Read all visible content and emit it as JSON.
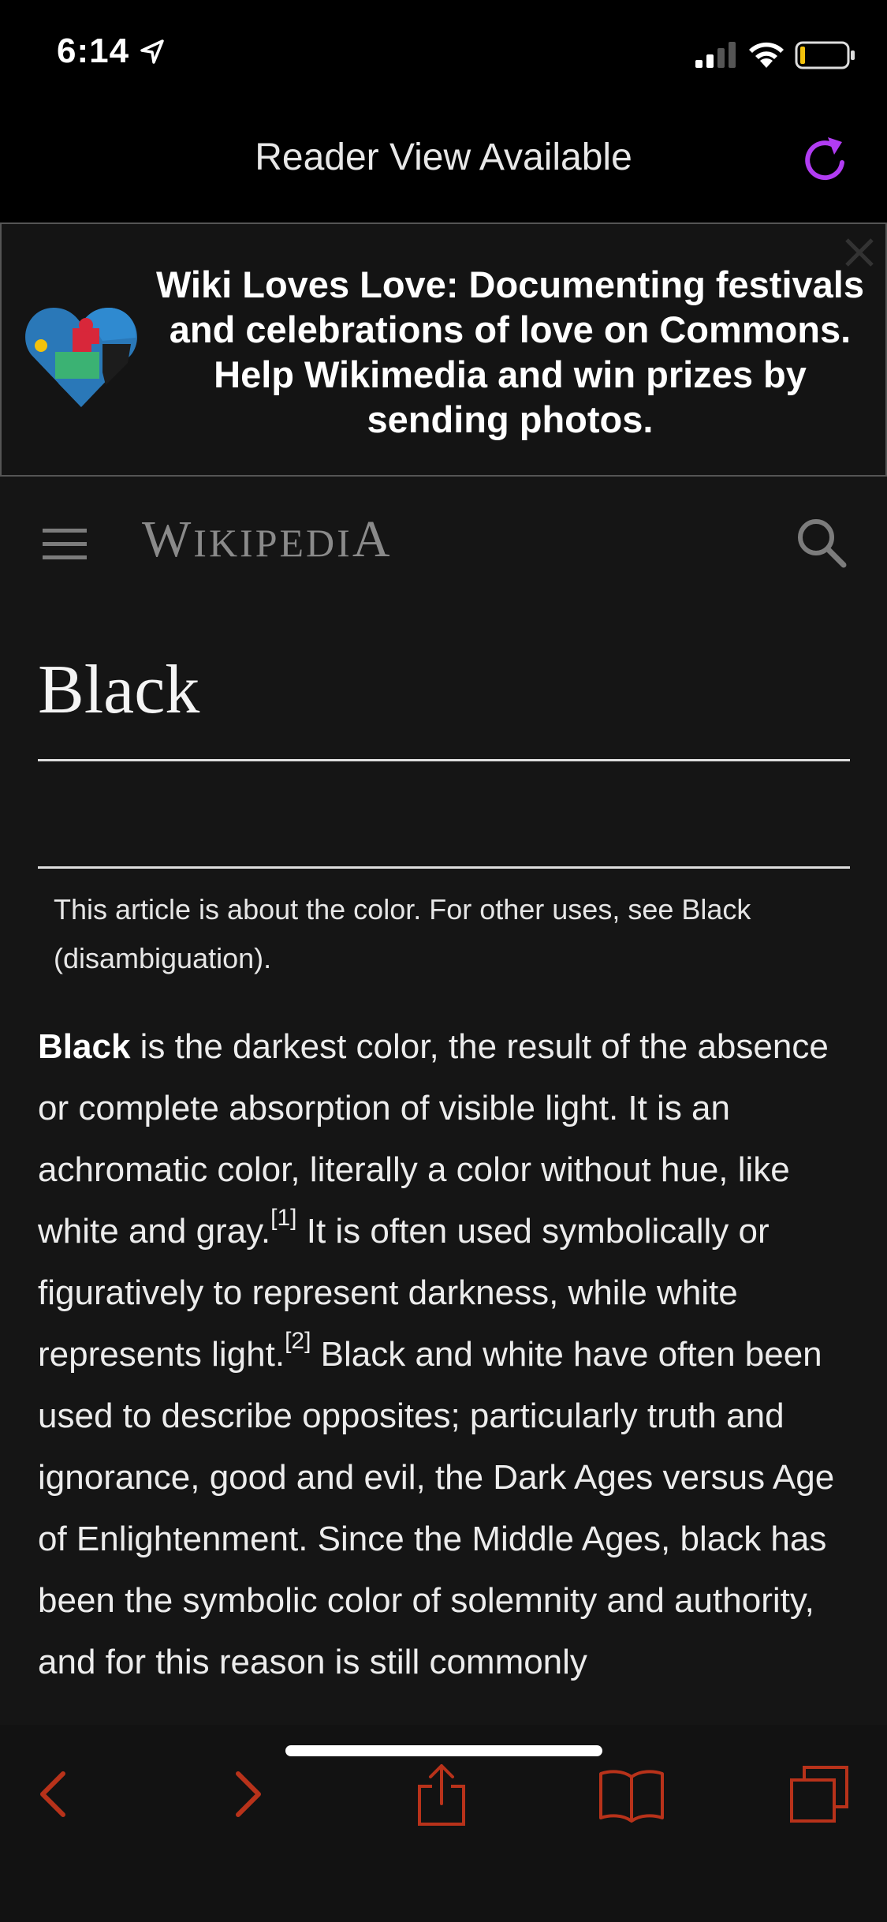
{
  "status_bar": {
    "time": "6:14"
  },
  "safari": {
    "reader_label": "Reader View Available",
    "accent_color": "#b13cf2"
  },
  "banner": {
    "text": "Wiki Loves Love: Documenting festivals and celebrations of love on Commons. Help Wikimedia and win prizes by sending photos."
  },
  "header": {
    "logo_first": "W",
    "logo_middle": "IKIPEDI",
    "logo_last": "A"
  },
  "article": {
    "title": "Black",
    "hatnote_prefix": "This article is about the color. For other uses, see ",
    "hatnote_link": "Black (disambiguation)",
    "hatnote_suffix": ".",
    "p_bold": "Black",
    "p_1": " is the darkest color, the result of the absence or complete absorption of visible light. It is an achromatic color, literally a color without hue, like white and gray.",
    "ref_1": "[1]",
    "p_2": " It is often used symbolically or figuratively to represent darkness, while white represents light.",
    "ref_2": "[2]",
    "p_3": " Black and white have often been used to describe opposites; particularly truth and ignorance, good and evil, the Dark Ages versus Age of Enlightenment. Since the Middle Ages, black has been the symbolic color of solemnity and authority, and for this reason is still commonly"
  },
  "toolbar": {
    "tint_color": "#b8321a"
  }
}
